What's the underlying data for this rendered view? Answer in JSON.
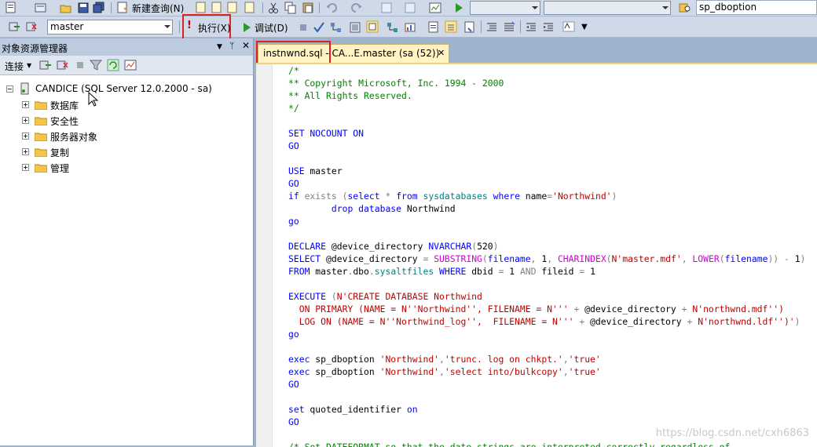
{
  "toolbar1": {
    "new_query": "新建查询(N)",
    "proc_combo_value": "sp_dboption"
  },
  "toolbar2": {
    "database": "master",
    "execute": "执行(X)",
    "debug": "调试(D)"
  },
  "object_explorer": {
    "title": "对象资源管理器",
    "connect": "连接",
    "server": "CANDICE (SQL Server 12.0.2000 - sa)",
    "nodes": [
      "数据库",
      "安全性",
      "服务器对象",
      "复制",
      "管理"
    ]
  },
  "editor": {
    "tab_label": "instnwnd.sql - CA...E.master (sa (52))",
    "watermark": "https://blog.csdn.net/cxh6863",
    "code_lines": [
      [
        [
          "c",
          "/*"
        ]
      ],
      [
        [
          "c",
          "** Copyright Microsoft, Inc. 1994 - 2000"
        ]
      ],
      [
        [
          "c",
          "** All Rights Reserved."
        ]
      ],
      [
        [
          "c",
          "*/"
        ]
      ],
      [],
      [
        [
          "k",
          "SET NOCOUNT ON"
        ]
      ],
      [
        [
          "k",
          "GO"
        ]
      ],
      [],
      [
        [
          "k",
          "USE"
        ],
        [
          "p",
          " master"
        ]
      ],
      [
        [
          "k",
          "GO"
        ]
      ],
      [
        [
          "k",
          "if"
        ],
        [
          "p",
          " "
        ],
        [
          "g",
          "exists"
        ],
        [
          "p",
          " "
        ],
        [
          "g",
          "("
        ],
        [
          "k",
          "select"
        ],
        [
          "p",
          " "
        ],
        [
          "g",
          "*"
        ],
        [
          "p",
          " "
        ],
        [
          "k",
          "from"
        ],
        [
          "p",
          " "
        ],
        [
          "t",
          "sysdatabases"
        ],
        [
          "p",
          " "
        ],
        [
          "k",
          "where"
        ],
        [
          "p",
          " name"
        ],
        [
          "g",
          "="
        ],
        [
          "s",
          "'Northwind'"
        ],
        [
          "g",
          ")"
        ]
      ],
      [
        [
          "p",
          "        "
        ],
        [
          "k",
          "drop database"
        ],
        [
          "p",
          " Northwind"
        ]
      ],
      [
        [
          "k",
          "go"
        ]
      ],
      [],
      [
        [
          "k",
          "DECLARE"
        ],
        [
          "p",
          " @device_directory "
        ],
        [
          "k",
          "NVARCHAR"
        ],
        [
          "g",
          "("
        ],
        [
          "p",
          "520"
        ],
        [
          "g",
          ")"
        ]
      ],
      [
        [
          "k",
          "SELECT"
        ],
        [
          "p",
          " @device_directory "
        ],
        [
          "g",
          "="
        ],
        [
          "p",
          " "
        ],
        [
          "f",
          "SUBSTRING"
        ],
        [
          "g",
          "("
        ],
        [
          "k",
          "filename"
        ],
        [
          "g",
          ","
        ],
        [
          "p",
          " 1"
        ],
        [
          "g",
          ","
        ],
        [
          "p",
          " "
        ],
        [
          "f",
          "CHARINDEX"
        ],
        [
          "g",
          "("
        ],
        [
          "s",
          "N'master.mdf'"
        ],
        [
          "g",
          ","
        ],
        [
          "p",
          " "
        ],
        [
          "f",
          "LOWER"
        ],
        [
          "g",
          "("
        ],
        [
          "k",
          "filename"
        ],
        [
          "g",
          "))"
        ],
        [
          "p",
          " "
        ],
        [
          "g",
          "-"
        ],
        [
          "p",
          " 1"
        ],
        [
          "g",
          ")"
        ]
      ],
      [
        [
          "k",
          "FROM"
        ],
        [
          "p",
          " master"
        ],
        [
          "g",
          "."
        ],
        [
          "p",
          "dbo"
        ],
        [
          "g",
          "."
        ],
        [
          "t",
          "sysaltfiles"
        ],
        [
          "p",
          " "
        ],
        [
          "k",
          "WHERE"
        ],
        [
          "p",
          " dbid "
        ],
        [
          "g",
          "="
        ],
        [
          "p",
          " 1 "
        ],
        [
          "g",
          "AND"
        ],
        [
          "p",
          " fileid "
        ],
        [
          "g",
          "="
        ],
        [
          "p",
          " 1"
        ]
      ],
      [],
      [
        [
          "k",
          "EXECUTE"
        ],
        [
          "p",
          " "
        ],
        [
          "g",
          "("
        ],
        [
          "s",
          "N'CREATE DATABASE Northwind"
        ]
      ],
      [
        [
          "s",
          "  ON PRIMARY (NAME = N''Northwind'', FILENAME = N'''"
        ],
        [
          "p",
          " "
        ],
        [
          "g",
          "+"
        ],
        [
          "p",
          " @device_directory "
        ],
        [
          "g",
          "+"
        ],
        [
          "p",
          " "
        ],
        [
          "s",
          "N'northwnd.mdf'')"
        ]
      ],
      [
        [
          "s",
          "  LOG ON (NAME = N''Northwind_log'',  FILENAME = N'''"
        ],
        [
          "p",
          " "
        ],
        [
          "g",
          "+"
        ],
        [
          "p",
          " @device_directory "
        ],
        [
          "g",
          "+"
        ],
        [
          "p",
          " "
        ],
        [
          "s",
          "N'northwnd.ldf'')'"
        ],
        [
          "g",
          ")"
        ]
      ],
      [
        [
          "k",
          "go"
        ]
      ],
      [],
      [
        [
          "k",
          "exec"
        ],
        [
          "p",
          " sp_dboption "
        ],
        [
          "s",
          "'Northwind'"
        ],
        [
          "g",
          ","
        ],
        [
          "s",
          "'trunc. log on chkpt.'"
        ],
        [
          "g",
          ","
        ],
        [
          "s",
          "'true'"
        ]
      ],
      [
        [
          "k",
          "exec"
        ],
        [
          "p",
          " sp_dboption "
        ],
        [
          "s",
          "'Northwind'"
        ],
        [
          "g",
          ","
        ],
        [
          "s",
          "'select into/bulkcopy'"
        ],
        [
          "g",
          ","
        ],
        [
          "s",
          "'true'"
        ]
      ],
      [
        [
          "k",
          "GO"
        ]
      ],
      [],
      [
        [
          "k",
          "set"
        ],
        [
          "p",
          " quoted_identifier "
        ],
        [
          "k",
          "on"
        ]
      ],
      [
        [
          "k",
          "GO"
        ]
      ],
      [],
      [
        [
          "c",
          "/* Set DATEFORMAT so that the date strings are interpreted correctly regardless of"
        ]
      ]
    ]
  }
}
